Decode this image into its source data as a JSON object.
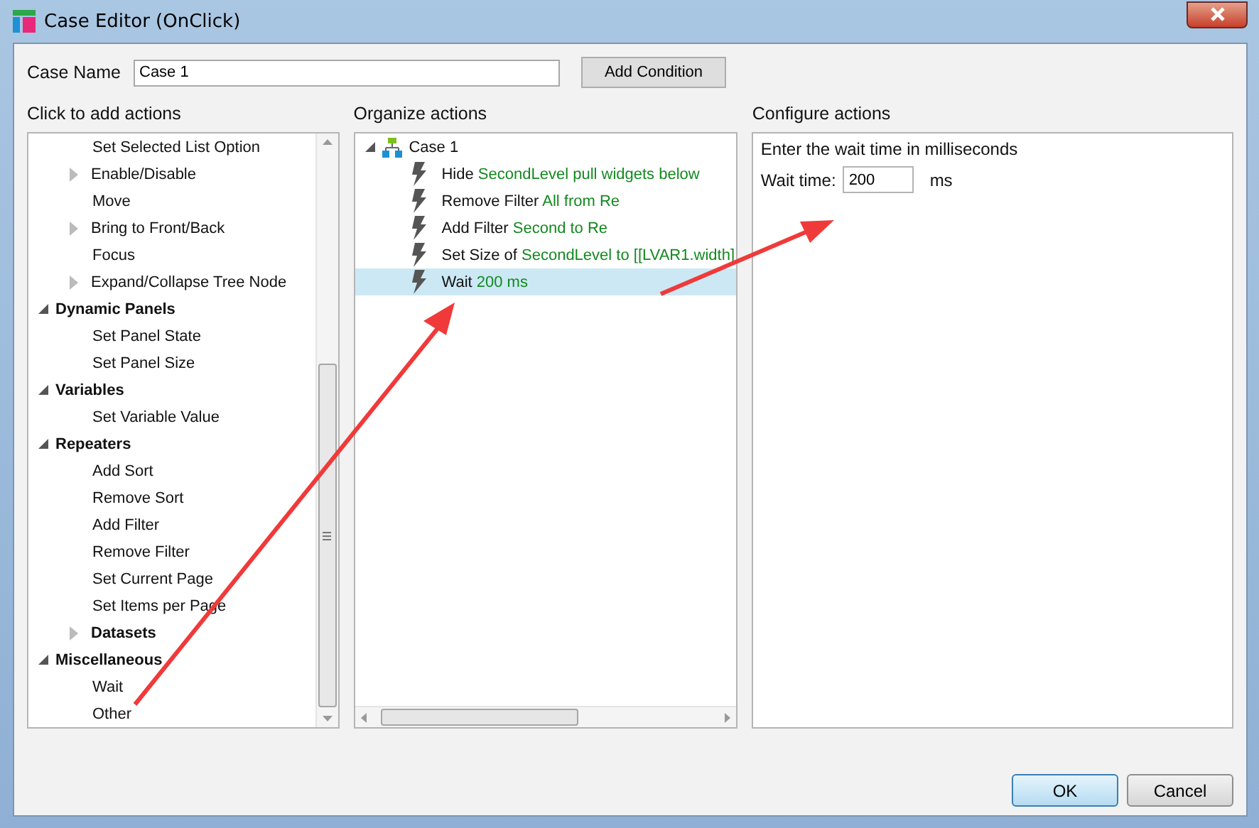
{
  "window": {
    "title": "Case Editor (OnClick)"
  },
  "case_name": {
    "label": "Case Name",
    "value": "Case 1"
  },
  "add_condition_button": "Add Condition",
  "actions_panel": {
    "title": "Click to add actions",
    "tree": [
      {
        "children": [
          {
            "label": "Set Selected List Option"
          },
          {
            "label": "Enable/Disable",
            "expanded": false
          },
          {
            "label": "Move"
          },
          {
            "label": "Bring to Front/Back",
            "expanded": false
          },
          {
            "label": "Focus"
          },
          {
            "label": "Expand/Collapse Tree Node",
            "expanded": false
          }
        ]
      },
      {
        "label": "Dynamic Panels",
        "expanded": true,
        "children": [
          {
            "label": "Set Panel State"
          },
          {
            "label": "Set Panel Size"
          }
        ]
      },
      {
        "label": "Variables",
        "expanded": true,
        "children": [
          {
            "label": "Set Variable Value"
          }
        ]
      },
      {
        "label": "Repeaters",
        "expanded": true,
        "children": [
          {
            "label": "Add Sort"
          },
          {
            "label": "Remove Sort"
          },
          {
            "label": "Add Filter"
          },
          {
            "label": "Remove Filter"
          },
          {
            "label": "Set Current Page"
          },
          {
            "label": "Set Items per Page"
          },
          {
            "label": "Datasets",
            "expanded": false,
            "bold": true
          }
        ]
      },
      {
        "label": "Miscellaneous",
        "expanded": true,
        "children": [
          {
            "label": "Wait"
          },
          {
            "label": "Other"
          }
        ]
      }
    ]
  },
  "organize_panel": {
    "title": "Organize actions",
    "case": {
      "label": "Case 1",
      "expanded": true,
      "actions": [
        {
          "verb": "Hide",
          "detail": "SecondLevel pull widgets below",
          "selected": false
        },
        {
          "verb": "Remove Filter",
          "detail": "All from Re",
          "selected": false
        },
        {
          "verb": "Add Filter",
          "detail": "Second to Re",
          "selected": false
        },
        {
          "verb": "Set Size of",
          "detail": "SecondLevel to [[LVAR1.width]",
          "selected": false
        },
        {
          "verb": "Wait",
          "detail": "200 ms",
          "selected": true
        }
      ]
    }
  },
  "configure_panel": {
    "title": "Configure actions",
    "instruction": "Enter the wait time in milliseconds",
    "field_label": "Wait time:",
    "value": "200",
    "unit": "ms"
  },
  "buttons": [
    "OK",
    "Cancel"
  ]
}
